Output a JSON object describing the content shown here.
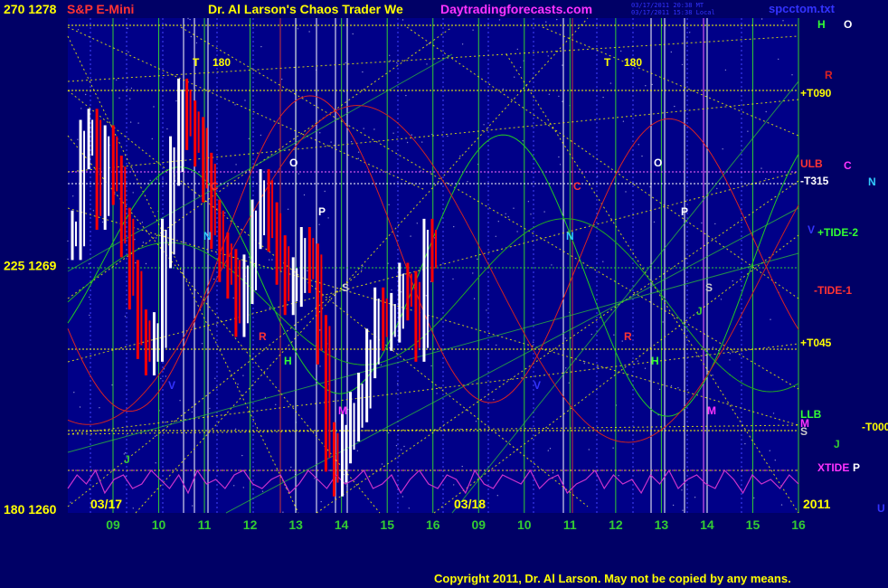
{
  "header": {
    "left_values": "270  1278",
    "title_left": "S&P E-Mini",
    "title_main": "Dr. Al Larson's Chaos Trader We",
    "site": "Daytradingforecasts.com",
    "stamp_line1": "03/17/2011 20:38 MT",
    "stamp_line2": "03/17/2011 15:38 Local",
    "file": "spcctom.txt",
    "hdr_h": "H",
    "hdr_o": "O"
  },
  "copyright": "Copyright 2011, Dr. Al Larson. May not be copied by any means.",
  "colors": {
    "background": "#000066",
    "plot_bg": "#000088",
    "grid_green": "#33cc33",
    "grid_yellow": "#ffff00",
    "price_up": "#ffffff",
    "price_down": "#ff0000",
    "red_line": "#dd2222",
    "green_line": "#22cc22",
    "magenta_line": "#cc33cc",
    "blue_line": "#3333ff"
  },
  "chart_data": {
    "type": "line",
    "title": "S&P E-Mini",
    "y_price_ticks": [
      {
        "angle": "270",
        "price": "1278",
        "value": 1278
      },
      {
        "angle": "225",
        "price": "1269",
        "value": 1269
      },
      {
        "angle": "180",
        "price": "1260",
        "value": 1260
      }
    ],
    "ylim": [
      1260,
      1278
    ],
    "x_tick_labels": [
      "09",
      "10",
      "11",
      "12",
      "13",
      "14",
      "15",
      "16",
      "09",
      "10",
      "11",
      "12",
      "13",
      "14",
      "15",
      "16"
    ],
    "date_labels": [
      "03/17",
      "03/18"
    ],
    "year_label": "2011",
    "right_labels": [
      {
        "text": "R",
        "color": "#dd2222"
      },
      {
        "text": "+T090",
        "color": "#ffff00"
      },
      {
        "text": "ULB",
        "color": "#ff3333"
      },
      {
        "text": "C",
        "color": "#ff33ff"
      },
      {
        "text": "N",
        "color": "#33ccff"
      },
      {
        "text": "-T315",
        "color": "#ffffff"
      },
      {
        "text": "V",
        "color": "#3333ff"
      },
      {
        "text": "+TIDE-2",
        "color": "#33ff33"
      },
      {
        "text": "-TIDE-1",
        "color": "#ff3333"
      },
      {
        "text": "+T045",
        "color": "#ffff00"
      },
      {
        "text": "LLB",
        "color": "#33ff33"
      },
      {
        "text": "M",
        "color": "#ff33ff"
      },
      {
        "text": "-T000",
        "color": "#ffff00"
      },
      {
        "text": "S",
        "color": "#cccccc"
      },
      {
        "text": "J",
        "color": "#33cc33"
      },
      {
        "text": "XTIDE",
        "color": "#ff33ff"
      },
      {
        "text": "P",
        "color": "#ffffff"
      },
      {
        "text": "U",
        "color": "#3333ff"
      }
    ],
    "plot_markers": [
      {
        "text": "T",
        "color": "#ffff00"
      },
      {
        "text": "180",
        "color": "#ffff00"
      },
      {
        "text": "T",
        "color": "#ffff00"
      },
      {
        "text": "180",
        "color": "#ffff00"
      },
      {
        "text": "O",
        "color": "#ffffff"
      },
      {
        "text": "O",
        "color": "#ffffff"
      },
      {
        "text": "P",
        "color": "#ffffff"
      },
      {
        "text": "P",
        "color": "#ffffff"
      },
      {
        "text": "S",
        "color": "#cccccc"
      },
      {
        "text": "S",
        "color": "#cccccc"
      },
      {
        "text": "N",
        "color": "#33ccff"
      },
      {
        "text": "N",
        "color": "#33ccff"
      },
      {
        "text": "H",
        "color": "#33ff33"
      },
      {
        "text": "H",
        "color": "#33ff33"
      },
      {
        "text": "V",
        "color": "#3333ff"
      },
      {
        "text": "V",
        "color": "#3333ff"
      },
      {
        "text": "M",
        "color": "#ff33ff"
      },
      {
        "text": "M",
        "color": "#ff33ff"
      },
      {
        "text": "R",
        "color": "#ff3333"
      },
      {
        "text": "R",
        "color": "#ff3333"
      },
      {
        "text": "J",
        "color": "#33cc33"
      },
      {
        "text": "J",
        "color": "#33cc33"
      },
      {
        "text": "C",
        "color": "#ff3333"
      },
      {
        "text": "C",
        "color": "#ff3333"
      }
    ],
    "price_series": [
      1270.1,
      1273.4,
      1273.8,
      1271.2,
      1273.2,
      1272.1,
      1270.2,
      1268.3,
      1266.5,
      1265.9,
      1266.4,
      1269.8,
      1272.8,
      1274.9,
      1274.1,
      1273.5,
      1272.2,
      1270.5,
      1269.3,
      1268.7,
      1267.3,
      1268.5,
      1270.5,
      1271.6,
      1270.4,
      1269.2,
      1268.1,
      1268.4,
      1269.5,
      1268.9,
      1266.3,
      1262.4,
      1261.5,
      1262.7,
      1263.5,
      1264.2,
      1265.8,
      1267.3,
      1266.8,
      1267.1,
      1268.2,
      1267.9,
      1266.4,
      1269.8,
      1269.3
    ],
    "magenta_xtide": [
      0.6,
      0.3,
      0.5,
      0.2,
      0.7,
      0.4,
      0.3,
      0.6,
      0.5,
      0.2,
      0.4,
      0.6,
      0.3,
      0.7,
      0.2,
      0.5,
      0.4,
      0.6,
      0.3,
      0.2,
      0.5,
      0.6,
      0.4,
      0.3,
      0.7,
      0.5,
      0.2,
      0.4,
      0.6,
      0.3,
      0.5,
      0.4,
      0.2,
      0.6,
      0.5,
      0.3,
      0.7,
      0.4,
      0.2,
      0.5,
      0.6,
      0.3,
      0.4,
      0.7,
      0.2,
      0.5,
      0.6,
      0.3,
      0.4,
      0.5,
      0.2,
      0.6,
      0.4,
      0.3,
      0.7,
      0.5,
      0.4,
      0.2,
      0.6,
      0.3,
      0.5,
      0.4,
      0.7,
      0.3,
      0.5,
      0.2,
      0.6,
      0.4,
      0.3,
      0.5,
      0.6,
      0.2,
      0.4,
      0.7,
      0.3,
      0.5,
      0.4,
      0.6,
      0.3,
      0.5
    ]
  }
}
